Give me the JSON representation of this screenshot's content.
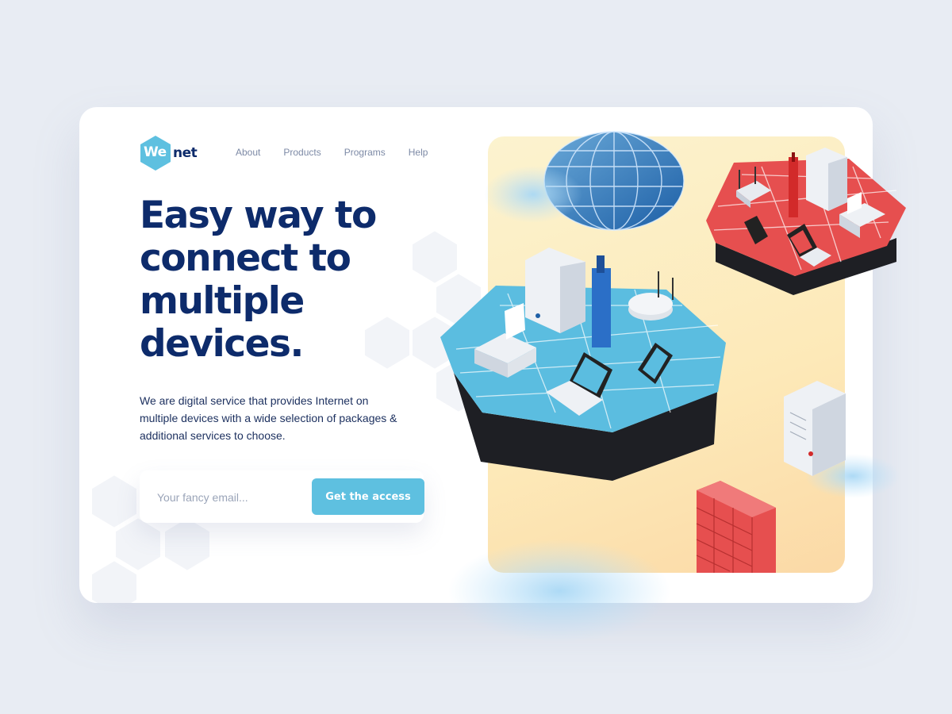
{
  "brand": {
    "logo_mark": "We",
    "logo_word": "net",
    "accent_color": "#5ec0e0",
    "text_color": "#0d2b6b"
  },
  "nav": {
    "items": [
      {
        "label": "About"
      },
      {
        "label": "Products"
      },
      {
        "label": "Programs"
      },
      {
        "label": "Help"
      }
    ]
  },
  "hero": {
    "headline": "Easy way to connect to multiple devices.",
    "description": "We are digital service that provides Internet on multiple devices with a wide selection of packages & additional services to choose."
  },
  "signup": {
    "email_placeholder": "Your fancy email...",
    "email_value": "",
    "button_label": "Get the access"
  },
  "illustration": {
    "icons": [
      "globe-icon",
      "server-icon",
      "router-icon",
      "tower-icon",
      "printer-icon",
      "laptop-icon",
      "tablet-icon",
      "firewall-icon",
      "cloud-icon"
    ]
  }
}
